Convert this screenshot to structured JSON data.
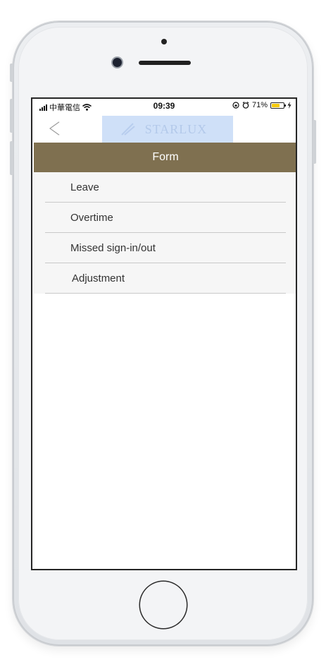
{
  "status_bar": {
    "carrier": "中華電信",
    "time": "09:39",
    "battery_percent": "71%",
    "battery_level": 0.71,
    "battery_color": "#f3c80d"
  },
  "nav": {
    "logo_text": "STARLUX",
    "logo_bg_color": "#cfe0f8"
  },
  "header": {
    "title": "Form",
    "bg_color": "#7f7050"
  },
  "menu": {
    "items": [
      {
        "label": "Leave"
      },
      {
        "label": "Overtime"
      },
      {
        "label": "Missed sign-in/out"
      },
      {
        "label": "Adjustment"
      }
    ]
  }
}
